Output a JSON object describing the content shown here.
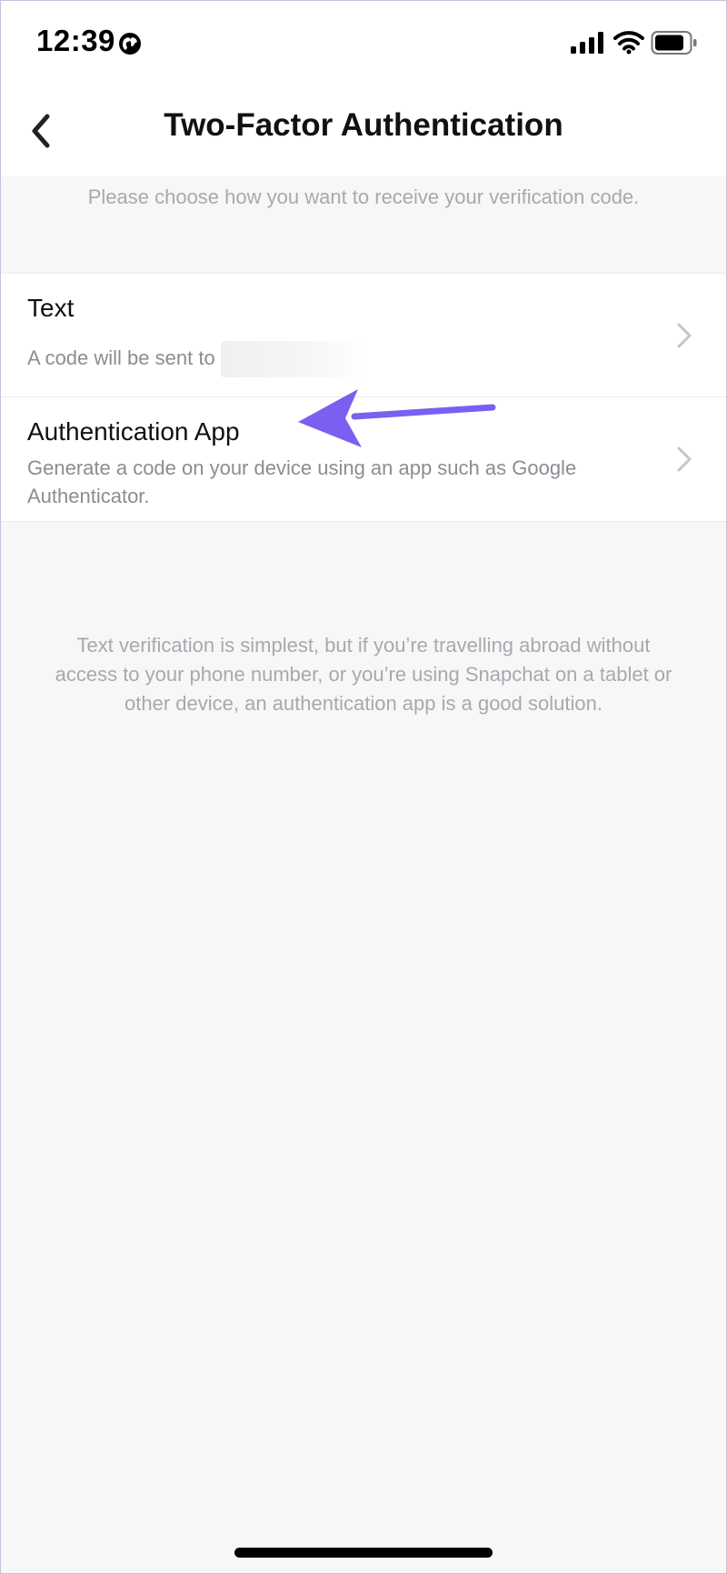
{
  "status_bar": {
    "time": "12:39",
    "icons": [
      "globe-icon",
      "signal-icon",
      "wifi-icon",
      "battery-icon"
    ]
  },
  "header": {
    "title": "Two-Factor Authentication",
    "back_icon": "chevron-left-icon"
  },
  "intro": "Please choose how you want to receive your verification code.",
  "options": [
    {
      "title": "Text",
      "description": "A code will be sent to",
      "chevron": "chevron-right-icon"
    },
    {
      "title": "Authentication App",
      "description": "Generate a code on your device using an app such as Google Authenticator.",
      "chevron": "chevron-right-icon"
    }
  ],
  "footer_note": "Text verification is simplest, but if you’re travelling abroad without access to your phone number, or you’re using Snapchat on a tablet or other device, an authentication app is a good solution.",
  "colors": {
    "background": "#f7f7f8",
    "surface": "#ffffff",
    "annotation_arrow": "#7b5ff0",
    "muted_text": "#a6a9ae"
  }
}
